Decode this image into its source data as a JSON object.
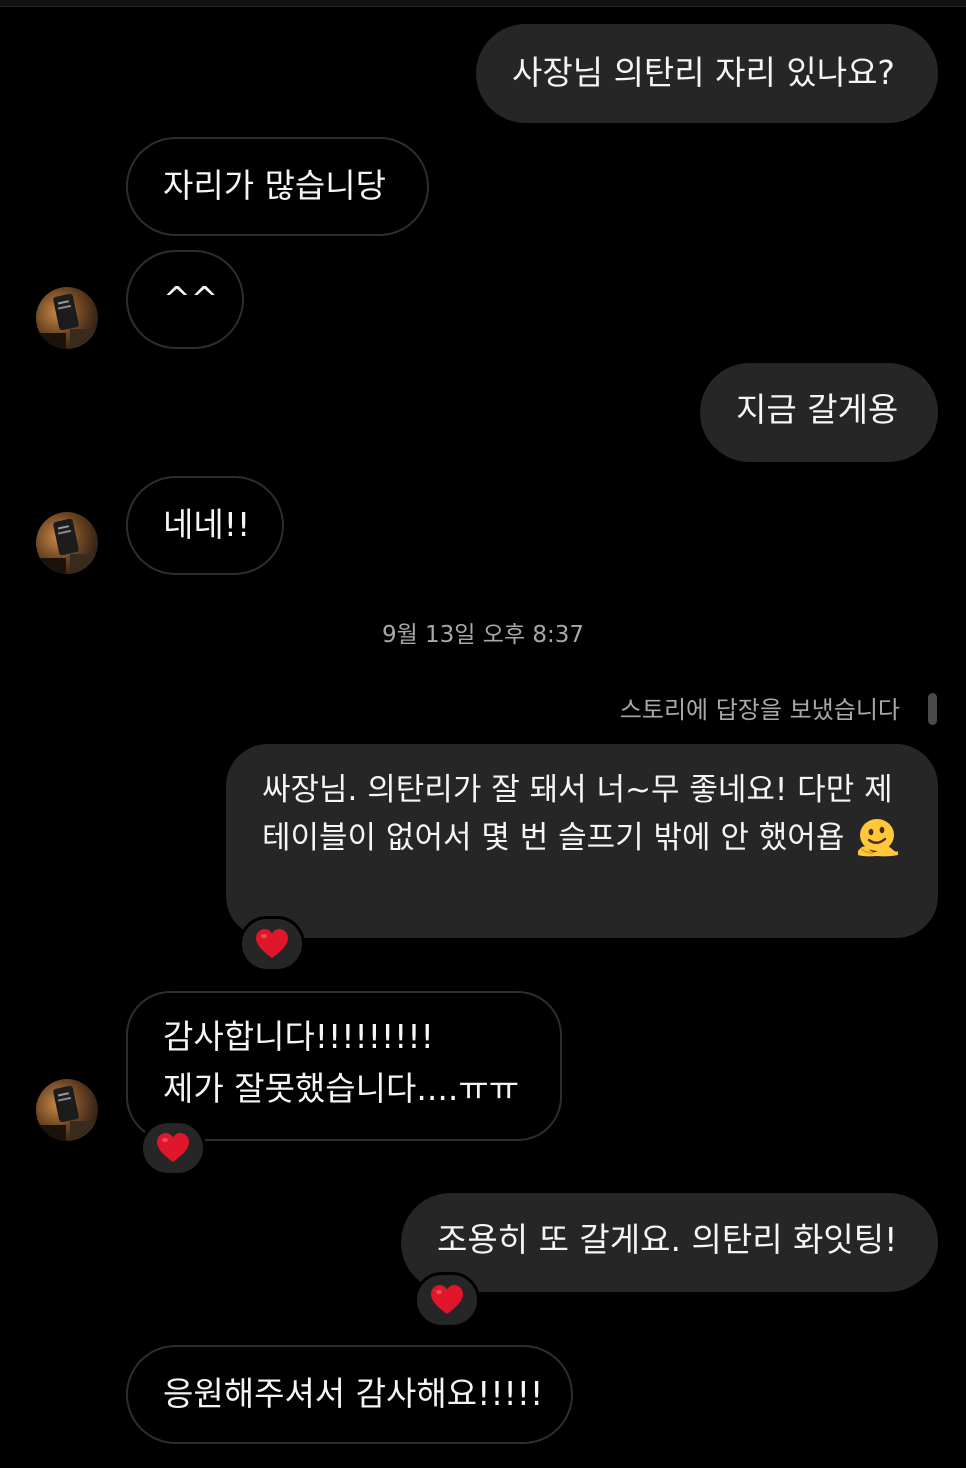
{
  "conversation": {
    "timestamp": "9월 13일 오후 8:37",
    "story_reply_note": "스토리에 답장을 보냈습니다",
    "messages": [
      {
        "text": "사장님 의탄리 자리 있나요?"
      },
      {
        "text": "자리가 많습니당"
      },
      {
        "text": "^^"
      },
      {
        "text": "지금 갈게용"
      },
      {
        "text": "네네!!"
      },
      {
        "text": "싸장님. 의탄리가 잘 돼서 너~무 좋네요! 다만 제 테이블이 없어서 몇 번 슬프기 밖에 안 했어욥",
        "emoji": "melting-face",
        "reaction": "heart"
      },
      {
        "text_line1": "감사합니다!!!!!!!!!",
        "text_line2": "제가 잘못했습니다....ㅠㅠ",
        "reaction": "heart"
      },
      {
        "text": "조용히 또 갈게요. 의탄리 화잇팅!",
        "reaction": "heart"
      },
      {
        "text": "응원해주셔서 감사해요!!!!!"
      }
    ]
  },
  "colors": {
    "background": "#000000",
    "outgoing_bubble": "#262626",
    "incoming_border": "#2e2e2e",
    "meta_text": "#a8a8a8",
    "heart": "#e0162b"
  }
}
